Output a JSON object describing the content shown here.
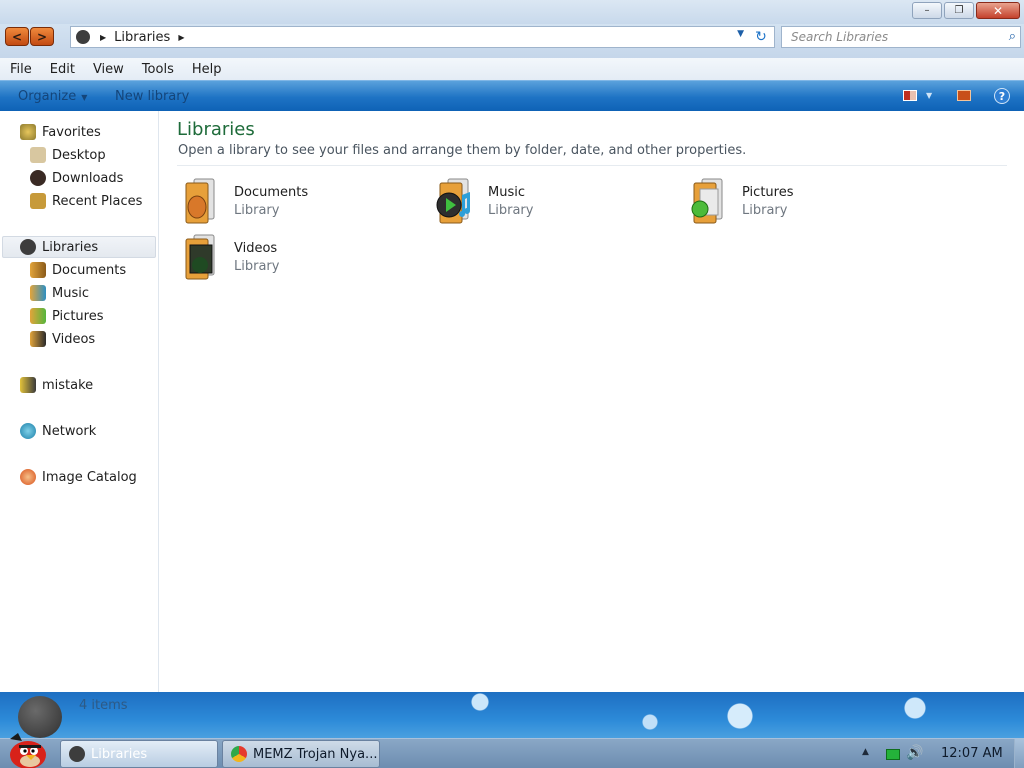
{
  "address": {
    "crumb": "Libraries"
  },
  "search": {
    "placeholder": "Search Libraries"
  },
  "menu": {
    "file": "File",
    "edit": "Edit",
    "view": "View",
    "tools": "Tools",
    "help": "Help"
  },
  "commands": {
    "organize": "Organize",
    "new_library": "New library"
  },
  "sidebar": {
    "favorites": {
      "label": "Favorites",
      "items": [
        "Desktop",
        "Downloads",
        "Recent Places"
      ]
    },
    "libraries": {
      "label": "Libraries",
      "items": [
        "Documents",
        "Music",
        "Pictures",
        "Videos"
      ]
    },
    "user": "mistake",
    "network": "Network",
    "image_catalog": "Image Catalog"
  },
  "main": {
    "title": "Libraries",
    "subtitle": "Open a library to see your files and arrange them by folder, date, and other properties.",
    "libraries": [
      {
        "name": "Documents",
        "type": "Library",
        "icon": "documents-library-icon"
      },
      {
        "name": "Music",
        "type": "Library",
        "icon": "music-library-icon"
      },
      {
        "name": "Pictures",
        "type": "Library",
        "icon": "pictures-library-icon"
      },
      {
        "name": "Videos",
        "type": "Library",
        "icon": "videos-library-icon"
      }
    ]
  },
  "details": {
    "count": "4 items"
  },
  "taskbar": {
    "windows": [
      "Libraries",
      "MEMZ Trojan Nya..."
    ],
    "clock": "12:07 AM"
  },
  "colors": {
    "title_green": "#1e6b3a",
    "command_bar_blue": "#1e73c4",
    "close_red": "#c4412c"
  }
}
